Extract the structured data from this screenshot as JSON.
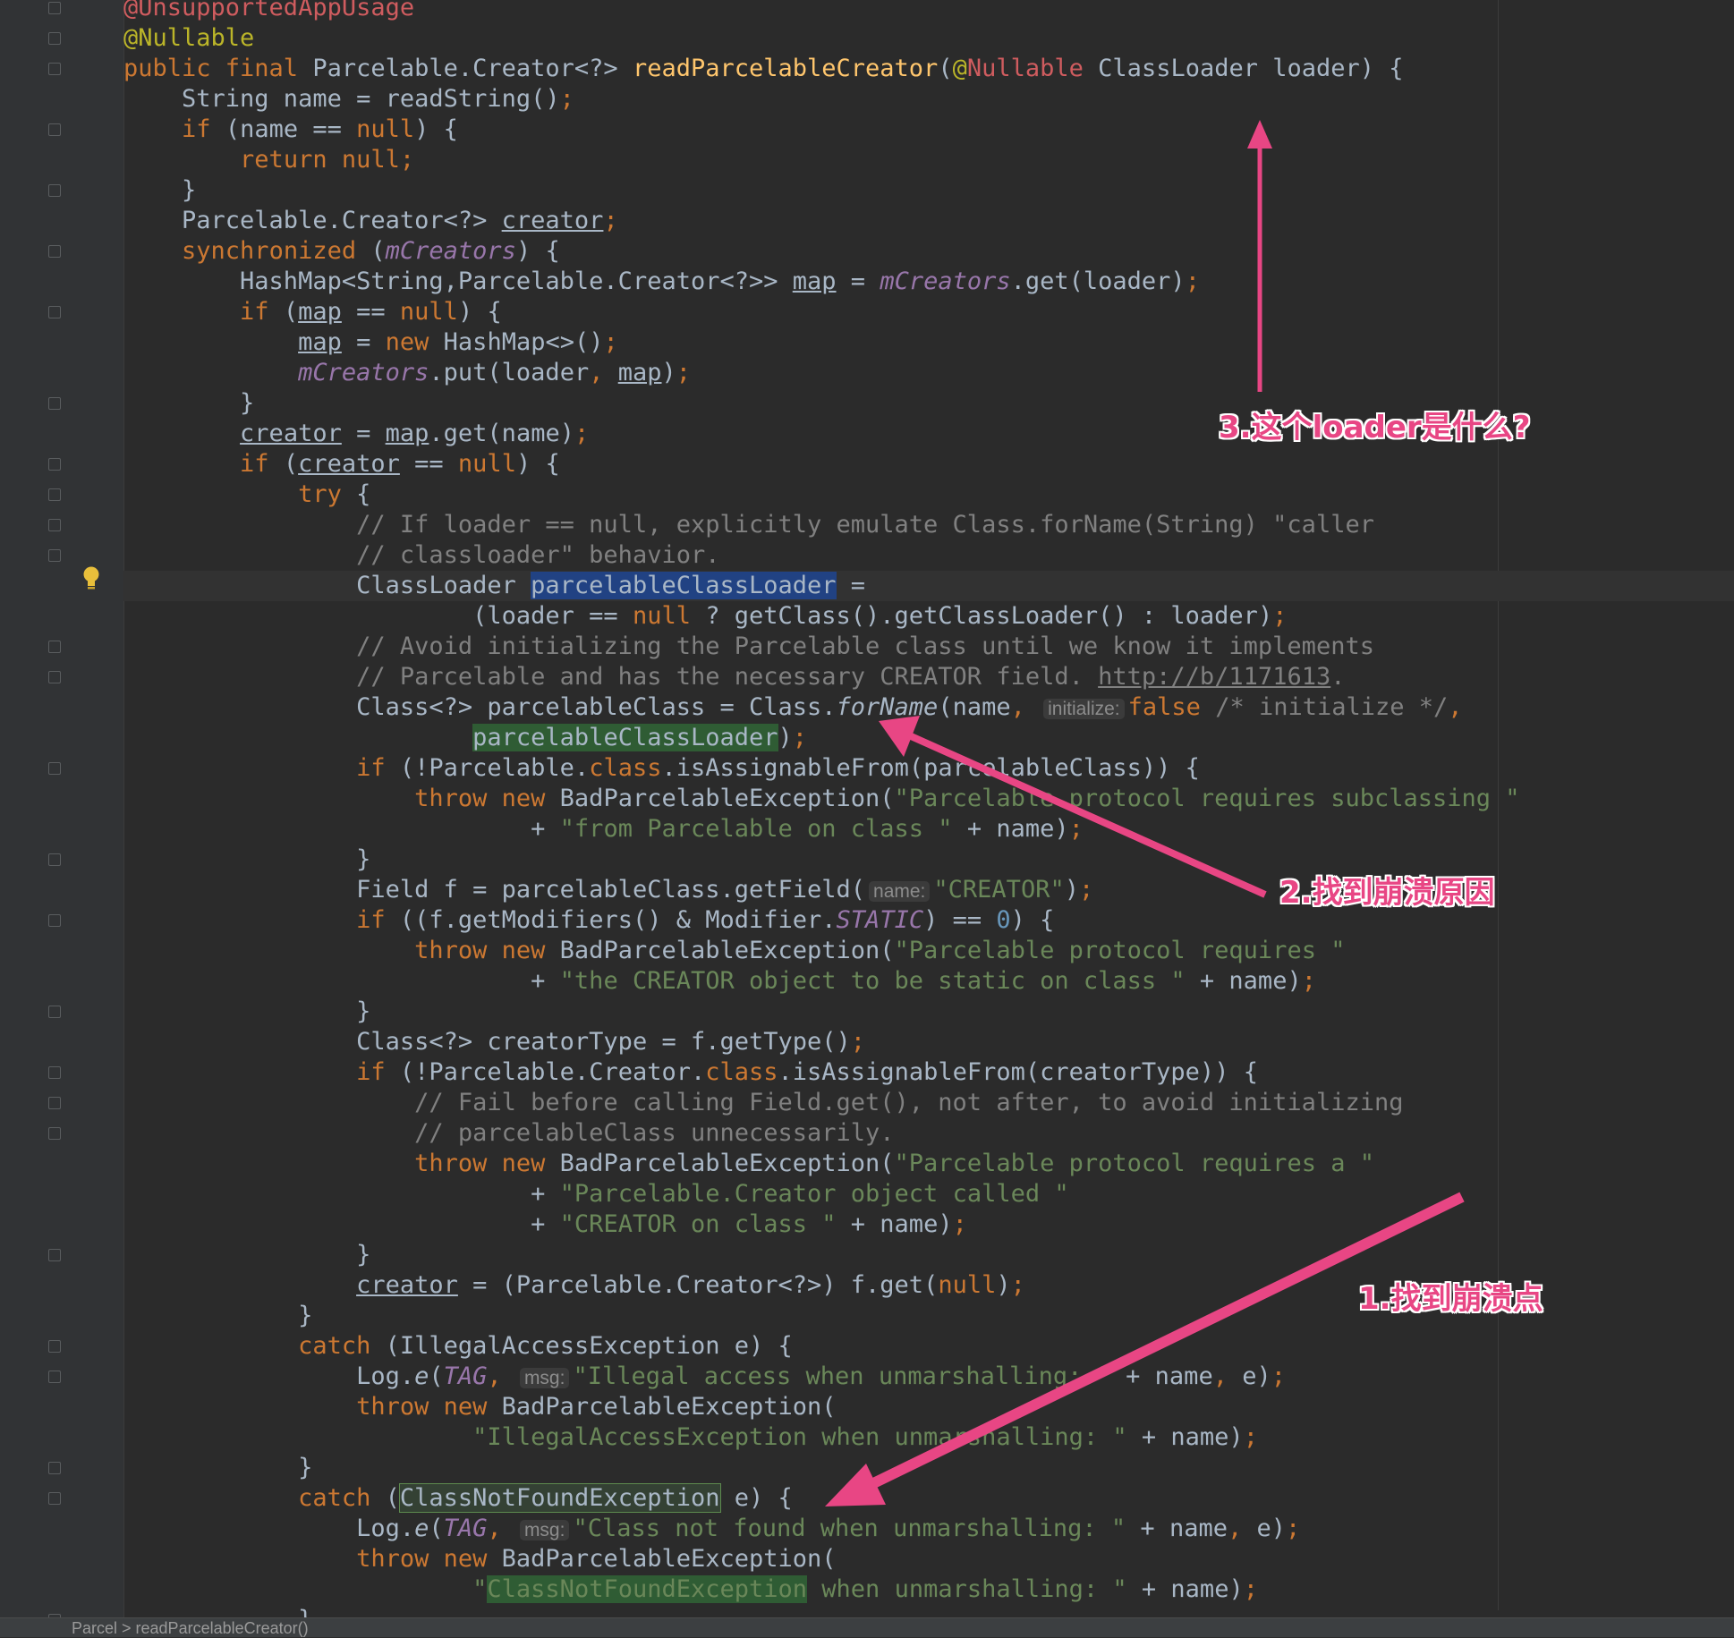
{
  "editor": {
    "colors": {
      "background": "#2b2b2b",
      "keyword": "#cc7832",
      "string": "#6a8759",
      "comment": "#808080",
      "field": "#9876aa",
      "method": "#ffc66d",
      "annotation": "#bbb529",
      "annotation_arrow": "#e84684"
    },
    "lines": [
      [
        {
          "t": "@UnsupportedAppUsage",
          "c": "ann2"
        }
      ],
      [
        {
          "t": "@Nullable",
          "c": "ann"
        }
      ],
      [
        {
          "t": "public final ",
          "c": "kw"
        },
        {
          "t": "Parcelable.Creator<?> "
        },
        {
          "t": "readParcelableCreator",
          "c": "mth"
        },
        {
          "t": "("
        },
        {
          "t": "@",
          "c": "ann"
        },
        {
          "t": "Nullable ",
          "c": "ann2"
        },
        {
          "t": "ClassLoader loader) {"
        }
      ],
      [
        {
          "t": "    String name = readString()"
        },
        {
          "t": ";",
          "c": "kw"
        }
      ],
      [
        {
          "t": "    "
        },
        {
          "t": "if ",
          "c": "kw"
        },
        {
          "t": "(name == "
        },
        {
          "t": "null",
          "c": "kw"
        },
        {
          "t": ") {"
        }
      ],
      [
        {
          "t": "        "
        },
        {
          "t": "return null;",
          "c": "kw"
        }
      ],
      [
        {
          "t": "    }"
        }
      ],
      [
        {
          "t": "    Parcelable.Creator<?> "
        },
        {
          "t": "creator",
          "c": "ul"
        },
        {
          "t": ";",
          "c": "kw"
        }
      ],
      [
        {
          "t": "    "
        },
        {
          "t": "synchronized ",
          "c": "kw"
        },
        {
          "t": "("
        },
        {
          "t": "mCreators",
          "c": "fld"
        },
        {
          "t": ") {"
        }
      ],
      [
        {
          "t": "        HashMap<String,Parcelable.Creator<?>> "
        },
        {
          "t": "map",
          "c": "ul"
        },
        {
          "t": " = "
        },
        {
          "t": "mCreators",
          "c": "fld"
        },
        {
          "t": ".get(loader)"
        },
        {
          "t": ";",
          "c": "kw"
        }
      ],
      [
        {
          "t": "        "
        },
        {
          "t": "if ",
          "c": "kw"
        },
        {
          "t": "("
        },
        {
          "t": "map",
          "c": "ul"
        },
        {
          "t": " == "
        },
        {
          "t": "null",
          "c": "kw"
        },
        {
          "t": ") {"
        }
      ],
      [
        {
          "t": "            "
        },
        {
          "t": "map",
          "c": "ul"
        },
        {
          "t": " = "
        },
        {
          "t": "new ",
          "c": "kw"
        },
        {
          "t": "HashMap<>()"
        },
        {
          "t": ";",
          "c": "kw"
        }
      ],
      [
        {
          "t": "            "
        },
        {
          "t": "mCreators",
          "c": "fld"
        },
        {
          "t": ".put(loader"
        },
        {
          "t": ", ",
          "c": "kw"
        },
        {
          "t": "map",
          "c": "ul"
        },
        {
          "t": ")"
        },
        {
          "t": ";",
          "c": "kw"
        }
      ],
      [
        {
          "t": "        }"
        }
      ],
      [
        {
          "t": "        "
        },
        {
          "t": "creator",
          "c": "ul"
        },
        {
          "t": " = "
        },
        {
          "t": "map",
          "c": "ul"
        },
        {
          "t": ".get(name)"
        },
        {
          "t": ";",
          "c": "kw"
        }
      ],
      [
        {
          "t": "        "
        },
        {
          "t": "if ",
          "c": "kw"
        },
        {
          "t": "("
        },
        {
          "t": "creator",
          "c": "ul"
        },
        {
          "t": " == "
        },
        {
          "t": "null",
          "c": "kw"
        },
        {
          "t": ") {"
        }
      ],
      [
        {
          "t": "            "
        },
        {
          "t": "try ",
          "c": "kw"
        },
        {
          "t": "{"
        }
      ],
      [
        {
          "t": "                // If loader == null, explicitly emulate Class.forName(String) \"caller",
          "c": "cmt"
        }
      ],
      [
        {
          "t": "                // classloader\" behavior.",
          "c": "cmt"
        }
      ],
      [
        {
          "t": "                ClassLoader "
        },
        {
          "t": "parcelableClassLoader",
          "c": "sel"
        },
        {
          "t": " ="
        }
      ],
      [
        {
          "t": "                        (loader == "
        },
        {
          "t": "null ",
          "c": "kw"
        },
        {
          "t": "? getClass().getClassLoader() : loader)"
        },
        {
          "t": ";",
          "c": "kw"
        }
      ],
      [
        {
          "t": "                // Avoid initializing the Parcelable class until we know it implements",
          "c": "cmt"
        }
      ],
      [
        {
          "t": "                // Parcelable and has the necessary CREATOR field. ",
          "c": "cmt"
        },
        {
          "t": "http://b/1171613",
          "c": "cmt ul"
        },
        {
          "t": ".",
          "c": "cmt"
        }
      ],
      [
        {
          "t": "                Class<?> parcelableClass = Class."
        },
        {
          "t": "forName",
          "c": "ital"
        },
        {
          "t": "(name"
        },
        {
          "t": ", ",
          "c": "kw"
        },
        {
          "t": "initialize:",
          "c": "hint"
        },
        {
          "t": "false ",
          "c": "kw"
        },
        {
          "t": "/* initialize */",
          "c": "cmt"
        },
        {
          "t": ",",
          "c": "kw"
        }
      ],
      [
        {
          "t": "                        "
        },
        {
          "t": "parcelableClassLoader",
          "c": "hl2"
        },
        {
          "t": ")"
        },
        {
          "t": ";",
          "c": "kw"
        }
      ],
      [
        {
          "t": "                "
        },
        {
          "t": "if ",
          "c": "kw"
        },
        {
          "t": "(!Parcelable."
        },
        {
          "t": "class",
          "c": "kw"
        },
        {
          "t": ".isAssignableFrom(parcelableClass)) {"
        }
      ],
      [
        {
          "t": "                    "
        },
        {
          "t": "throw new ",
          "c": "kw"
        },
        {
          "t": "BadParcelableException("
        },
        {
          "t": "\"Parcelable protocol requires subclassing \"",
          "c": "str"
        }
      ],
      [
        {
          "t": "                            + "
        },
        {
          "t": "\"from Parcelable on class \"",
          "c": "str"
        },
        {
          "t": " + name)"
        },
        {
          "t": ";",
          "c": "kw"
        }
      ],
      [
        {
          "t": "                }"
        }
      ],
      [
        {
          "t": "                Field f = parcelableClass.getField("
        },
        {
          "t": "name:",
          "c": "hint"
        },
        {
          "t": "\"CREATOR\"",
          "c": "str"
        },
        {
          "t": ")"
        },
        {
          "t": ";",
          "c": "kw"
        }
      ],
      [
        {
          "t": "                "
        },
        {
          "t": "if ",
          "c": "kw"
        },
        {
          "t": "((f.getModifiers() & Modifier."
        },
        {
          "t": "STATIC",
          "c": "fld"
        },
        {
          "t": ") == "
        },
        {
          "t": "0",
          "c": "num"
        },
        {
          "t": ") {"
        }
      ],
      [
        {
          "t": "                    "
        },
        {
          "t": "throw new ",
          "c": "kw"
        },
        {
          "t": "BadParcelableException("
        },
        {
          "t": "\"Parcelable protocol requires \"",
          "c": "str"
        }
      ],
      [
        {
          "t": "                            + "
        },
        {
          "t": "\"the CREATOR object to be static on class \"",
          "c": "str"
        },
        {
          "t": " + name)"
        },
        {
          "t": ";",
          "c": "kw"
        }
      ],
      [
        {
          "t": "                }"
        }
      ],
      [
        {
          "t": "                Class<?> creatorType = f.getType()"
        },
        {
          "t": ";",
          "c": "kw"
        }
      ],
      [
        {
          "t": "                "
        },
        {
          "t": "if ",
          "c": "kw"
        },
        {
          "t": "(!Parcelable.Creator."
        },
        {
          "t": "class",
          "c": "kw"
        },
        {
          "t": ".isAssignableFrom(creatorType)) {"
        }
      ],
      [
        {
          "t": "                    // Fail before calling Field.get(), not after, to avoid initializing",
          "c": "cmt"
        }
      ],
      [
        {
          "t": "                    // parcelableClass unnecessarily.",
          "c": "cmt"
        }
      ],
      [
        {
          "t": "                    "
        },
        {
          "t": "throw new ",
          "c": "kw"
        },
        {
          "t": "BadParcelableException("
        },
        {
          "t": "\"Parcelable protocol requires a \"",
          "c": "str"
        }
      ],
      [
        {
          "t": "                            + "
        },
        {
          "t": "\"Parcelable.Creator object called \"",
          "c": "str"
        }
      ],
      [
        {
          "t": "                            + "
        },
        {
          "t": "\"CREATOR on class \"",
          "c": "str"
        },
        {
          "t": " + name)"
        },
        {
          "t": ";",
          "c": "kw"
        }
      ],
      [
        {
          "t": "                }"
        }
      ],
      [
        {
          "t": "                "
        },
        {
          "t": "creator",
          "c": "ul"
        },
        {
          "t": " = (Parcelable.Creator<?>) f.get("
        },
        {
          "t": "null",
          "c": "kw"
        },
        {
          "t": ")"
        },
        {
          "t": ";",
          "c": "kw"
        }
      ],
      [
        {
          "t": "            }"
        }
      ],
      [
        {
          "t": "            "
        },
        {
          "t": "catch ",
          "c": "kw"
        },
        {
          "t": "(IllegalAccessException e) {"
        }
      ],
      [
        {
          "t": "                Log."
        },
        {
          "t": "e",
          "c": "ital"
        },
        {
          "t": "("
        },
        {
          "t": "TAG",
          "c": "fld"
        },
        {
          "t": ", ",
          "c": "kw"
        },
        {
          "t": "msg:",
          "c": "hint"
        },
        {
          "t": "\"Illegal access when unmarshalling: \"",
          "c": "str"
        },
        {
          "t": " + name"
        },
        {
          "t": ", ",
          "c": "kw"
        },
        {
          "t": "e)"
        },
        {
          "t": ";",
          "c": "kw"
        }
      ],
      [
        {
          "t": "                "
        },
        {
          "t": "throw new ",
          "c": "kw"
        },
        {
          "t": "BadParcelableException("
        }
      ],
      [
        {
          "t": "                        "
        },
        {
          "t": "\"IllegalAccessException when unmarshalling: \"",
          "c": "str"
        },
        {
          "t": " + name)"
        },
        {
          "t": ";",
          "c": "kw"
        }
      ],
      [
        {
          "t": "            }"
        }
      ],
      [
        {
          "t": "            "
        },
        {
          "t": "catch ",
          "c": "kw"
        },
        {
          "t": "("
        },
        {
          "t": "ClassNotFoundException",
          "c": "hl"
        },
        {
          "t": " e) {"
        }
      ],
      [
        {
          "t": "                Log."
        },
        {
          "t": "e",
          "c": "ital"
        },
        {
          "t": "("
        },
        {
          "t": "TAG",
          "c": "fld"
        },
        {
          "t": ", ",
          "c": "kw"
        },
        {
          "t": "msg:",
          "c": "hint"
        },
        {
          "t": "\"Class not found when unmarshalling: \"",
          "c": "str"
        },
        {
          "t": " + name"
        },
        {
          "t": ", ",
          "c": "kw"
        },
        {
          "t": "e)"
        },
        {
          "t": ";",
          "c": "kw"
        }
      ],
      [
        {
          "t": "                "
        },
        {
          "t": "throw new ",
          "c": "kw"
        },
        {
          "t": "BadParcelableException("
        }
      ],
      [
        {
          "t": "                        "
        },
        {
          "t": "\"",
          "c": "str"
        },
        {
          "t": "ClassNotFoundException",
          "c": "str hl2"
        },
        {
          "t": " when unmarshalling: \"",
          "c": "str"
        },
        {
          "t": " + name)"
        },
        {
          "t": ";",
          "c": "kw"
        }
      ],
      [
        {
          "t": "            }"
        }
      ]
    ],
    "status_bar": "Parcel > readParcelableCreator()"
  },
  "annotations": {
    "note_loader": "3.这个loader是什么?",
    "note_cause": "2.找到崩溃原因",
    "note_point": "1.找到崩溃点"
  }
}
